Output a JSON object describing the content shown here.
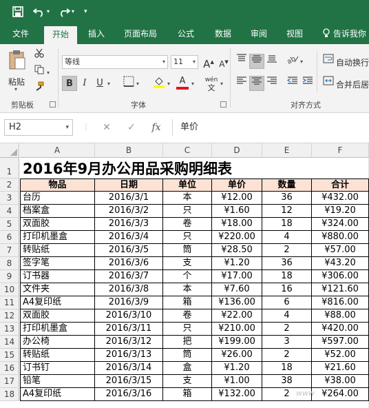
{
  "quick_access": {
    "save_icon": "save-icon",
    "undo_icon": "undo-icon",
    "redo_icon": "redo-icon",
    "customize_icon": "chevron-down-icon"
  },
  "tabs": [
    {
      "label": "文件",
      "active": false
    },
    {
      "label": "开始",
      "active": true
    },
    {
      "label": "插入",
      "active": false
    },
    {
      "label": "页面布局",
      "active": false
    },
    {
      "label": "公式",
      "active": false
    },
    {
      "label": "数据",
      "active": false
    },
    {
      "label": "审阅",
      "active": false
    },
    {
      "label": "视图",
      "active": false
    }
  ],
  "tell_me": "告诉我你",
  "ribbon": {
    "paste_label": "粘贴",
    "clipboard_label": "剪贴板",
    "font_label": "字体",
    "alignment_label": "对齐方式",
    "font_name": "等线",
    "font_size": "11",
    "bold": "B",
    "italic": "I",
    "underline": "U",
    "wrap_text": "自动换行",
    "merge_center": "合并后居",
    "grow_font": "A",
    "shrink_font": "A",
    "font_color_letter": "A",
    "phonetic": "wén"
  },
  "formula_bar": {
    "name_box": "H2",
    "cancel": "✕",
    "enter": "✓",
    "fx": "fx",
    "content": "单价"
  },
  "grid": {
    "columns": [
      "A",
      "B",
      "C",
      "D",
      "E",
      "F"
    ],
    "rows": [
      "1",
      "2",
      "3",
      "4",
      "5",
      "6",
      "7",
      "8",
      "9",
      "10",
      "11",
      "12",
      "13",
      "14",
      "15",
      "16",
      "17",
      "18"
    ],
    "title": "2016年9月办公用品采购明细表",
    "headers": [
      "物品",
      "日期",
      "单位",
      "单价",
      "数量",
      "合计"
    ],
    "data": [
      [
        "台历",
        "2016/3/1",
        "本",
        "¥12.00",
        "36",
        "¥432.00"
      ],
      [
        "档案盒",
        "2016/3/2",
        "只",
        "¥1.60",
        "12",
        "¥19.20"
      ],
      [
        "双面胶",
        "2016/3/3",
        "卷",
        "¥18.00",
        "18",
        "¥324.00"
      ],
      [
        "打印机墨盒",
        "2016/3/4",
        "只",
        "¥220.00",
        "4",
        "¥880.00"
      ],
      [
        "转贴纸",
        "2016/3/5",
        "筒",
        "¥28.50",
        "2",
        "¥57.00"
      ],
      [
        "签字笔",
        "2016/3/6",
        "支",
        "¥1.20",
        "36",
        "¥43.20"
      ],
      [
        "订书器",
        "2016/3/7",
        "个",
        "¥17.00",
        "18",
        "¥306.00"
      ],
      [
        "文件夹",
        "2016/3/8",
        "本",
        "¥7.60",
        "16",
        "¥121.60"
      ],
      [
        "A4复印纸",
        "2016/3/9",
        "箱",
        "¥136.00",
        "6",
        "¥816.00"
      ],
      [
        "双面胶",
        "2016/3/10",
        "卷",
        "¥22.00",
        "4",
        "¥88.00"
      ],
      [
        "打印机墨盒",
        "2016/3/11",
        "只",
        "¥210.00",
        "2",
        "¥420.00"
      ],
      [
        "办公椅",
        "2016/3/12",
        "把",
        "¥199.00",
        "3",
        "¥597.00"
      ],
      [
        "转贴纸",
        "2016/3/13",
        "筒",
        "¥26.00",
        "2",
        "¥52.00"
      ],
      [
        "订书钉",
        "2016/3/14",
        "盒",
        "¥1.20",
        "18",
        "¥21.60"
      ],
      [
        "铅笔",
        "2016/3/15",
        "支",
        "¥1.00",
        "38",
        "¥38.00"
      ],
      [
        "A4复印纸",
        "2016/3/16",
        "箱",
        "¥132.00",
        "2",
        "¥264.00"
      ]
    ]
  },
  "colors": {
    "accent": "#217346",
    "header_fill": "#fbe2d5",
    "font_color": "#e81123",
    "highlight": "#ffff00"
  }
}
